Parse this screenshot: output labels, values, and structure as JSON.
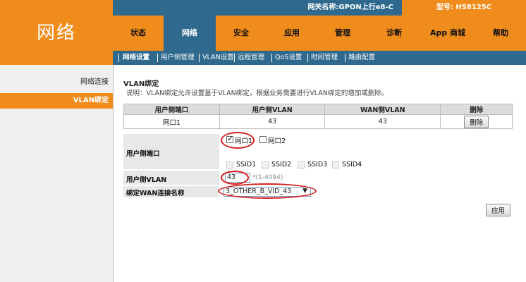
{
  "brand": {
    "logo_text": "网络"
  },
  "topbar": {
    "gateway_name": "网关名称:GPON上行e8-C",
    "model": "型号: HS8125C"
  },
  "nav": {
    "items": [
      {
        "label": "状态"
      },
      {
        "label": "网络",
        "active": true
      },
      {
        "label": "安全"
      },
      {
        "label": "应用"
      },
      {
        "label": "管理"
      },
      {
        "label": "诊断"
      },
      {
        "label": "App 商城"
      },
      {
        "label": "帮助"
      }
    ]
  },
  "subnav": {
    "items": [
      {
        "label": "网络设置",
        "active": true
      },
      {
        "label": "用户侧管理"
      },
      {
        "label": "VLAN设置"
      },
      {
        "label": "远程管理"
      },
      {
        "label": "QoS设置"
      },
      {
        "label": "时间管理"
      },
      {
        "label": "路由配置"
      }
    ]
  },
  "sidebar": {
    "items": [
      {
        "label": "网络连接"
      },
      {
        "label": "VLAN绑定",
        "active": true
      }
    ]
  },
  "main": {
    "title": "VLAN绑定",
    "description": "说明：VLAN绑定允许设置基于VLAN绑定，根据业务需要进行VLAN绑定的增加或删除。",
    "table": {
      "headers": [
        "用户侧端口",
        "用户侧VLAN",
        "WAN侧VLAN",
        "删除"
      ],
      "rows": [
        {
          "port": "网口1",
          "user_vlan": "43",
          "wan_vlan": "43",
          "delete_label": "删除"
        }
      ]
    },
    "form": {
      "port_label": "用户侧端口",
      "lan_ports": [
        {
          "label": "网口1",
          "checked": true
        },
        {
          "label": "网口2",
          "checked": false
        }
      ],
      "ssids": [
        {
          "label": "SSID1"
        },
        {
          "label": "SSID2"
        },
        {
          "label": "SSID3"
        },
        {
          "label": "SSID4"
        }
      ],
      "vlan_label": "用户侧VLAN",
      "vlan_value": "43",
      "vlan_hint": "*(1-4094)",
      "wan_label": "绑定WAN连接名称",
      "wan_value": "3_OTHER_B_VID_43"
    },
    "apply_label": "应用"
  },
  "colors": {
    "orange": "#f08c1c",
    "blue": "#2f6a8e",
    "highlight": "#d41f1f"
  }
}
